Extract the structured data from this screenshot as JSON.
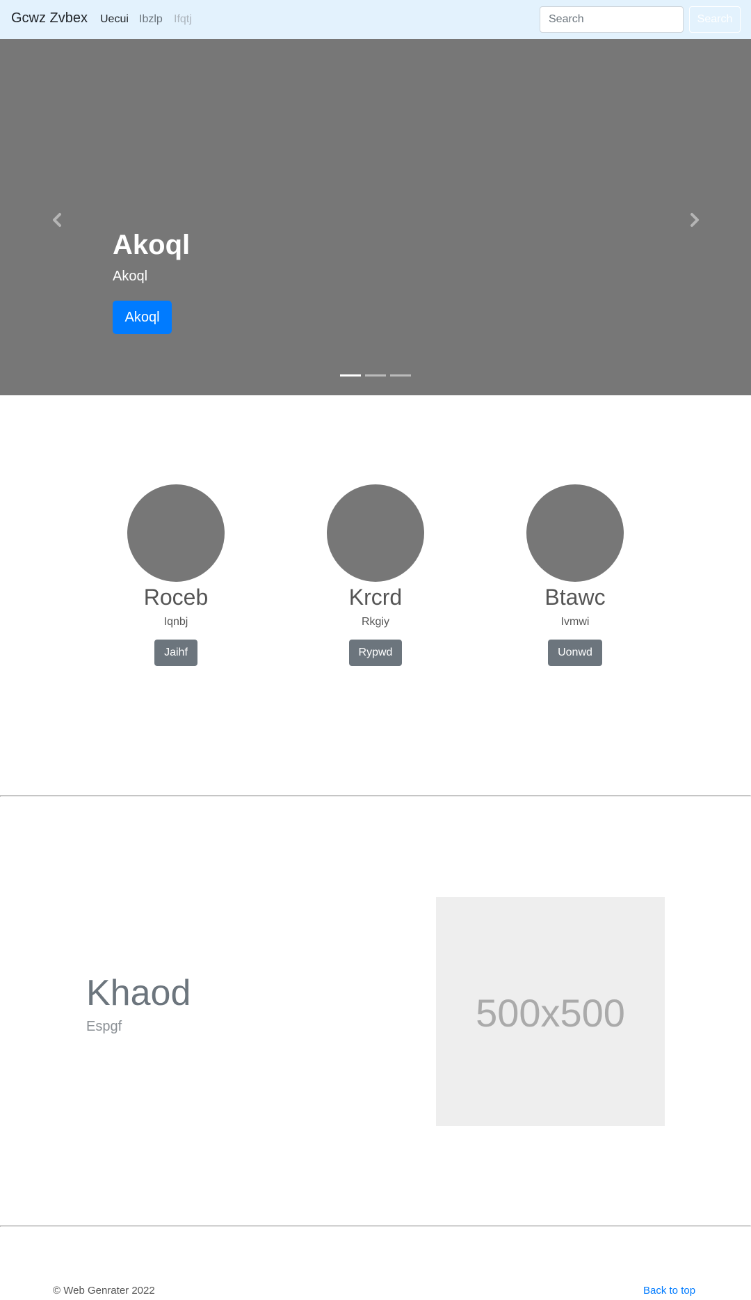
{
  "navbar": {
    "brand": "Gcwz Zvbex",
    "links": [
      "Uecui",
      "Ibzlp",
      "Ifqtj"
    ],
    "search_placeholder": "Search",
    "search_button": "Search",
    "background": "#e3f2fd"
  },
  "carousel": {
    "background": "#777777",
    "caption_title": "Akoql",
    "caption_text": "Akoql",
    "caption_button": "Akoql",
    "button_color": "#007bff",
    "slide_count": 3,
    "active_slide": 1,
    "prev_icon": "chevron-left-icon",
    "next_icon": "chevron-right-icon"
  },
  "marketing": {
    "columns": [
      {
        "heading": "Roceb",
        "text": "Iqnbj",
        "button": "Jaihf"
      },
      {
        "heading": "Krcrd",
        "text": "Rkgiy",
        "button": "Rypwd"
      },
      {
        "heading": "Btawc",
        "text": "Ivmwi",
        "button": "Uonwd"
      }
    ]
  },
  "featurette": {
    "heading": "Khaod",
    "text": "Espgf",
    "image_label": "500x500"
  },
  "footer": {
    "copyright": "© Web Genrater 2022",
    "back_to_top": "Back to top"
  }
}
